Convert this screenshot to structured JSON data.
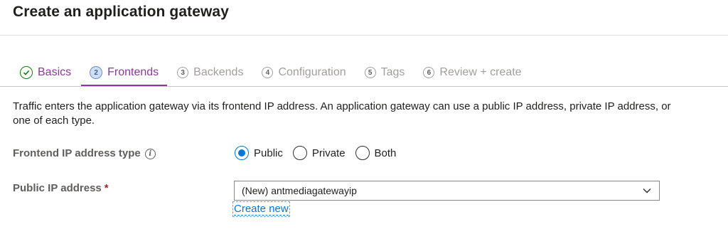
{
  "header": {
    "title": "Create an application gateway"
  },
  "tabs": [
    {
      "num": "",
      "label": "Basics"
    },
    {
      "num": "2",
      "label": "Frontends"
    },
    {
      "num": "3",
      "label": "Backends"
    },
    {
      "num": "4",
      "label": "Configuration"
    },
    {
      "num": "5",
      "label": "Tags"
    },
    {
      "num": "6",
      "label": "Review + create"
    }
  ],
  "description": "Traffic enters the application gateway via its frontend IP address. An application gateway can use a public IP address, private IP address, or one of each type.",
  "frontend_ip_type": {
    "label": "Frontend IP address type",
    "options": [
      "Public",
      "Private",
      "Both"
    ],
    "selected": "Public"
  },
  "public_ip": {
    "label": "Public IP address",
    "required_mark": "*",
    "value": "(New) antmediagatewayip",
    "create_new_label": "Create new"
  },
  "colors": {
    "accent": "#8a3a9a",
    "link": "#0078d4",
    "success": "#107c10"
  }
}
